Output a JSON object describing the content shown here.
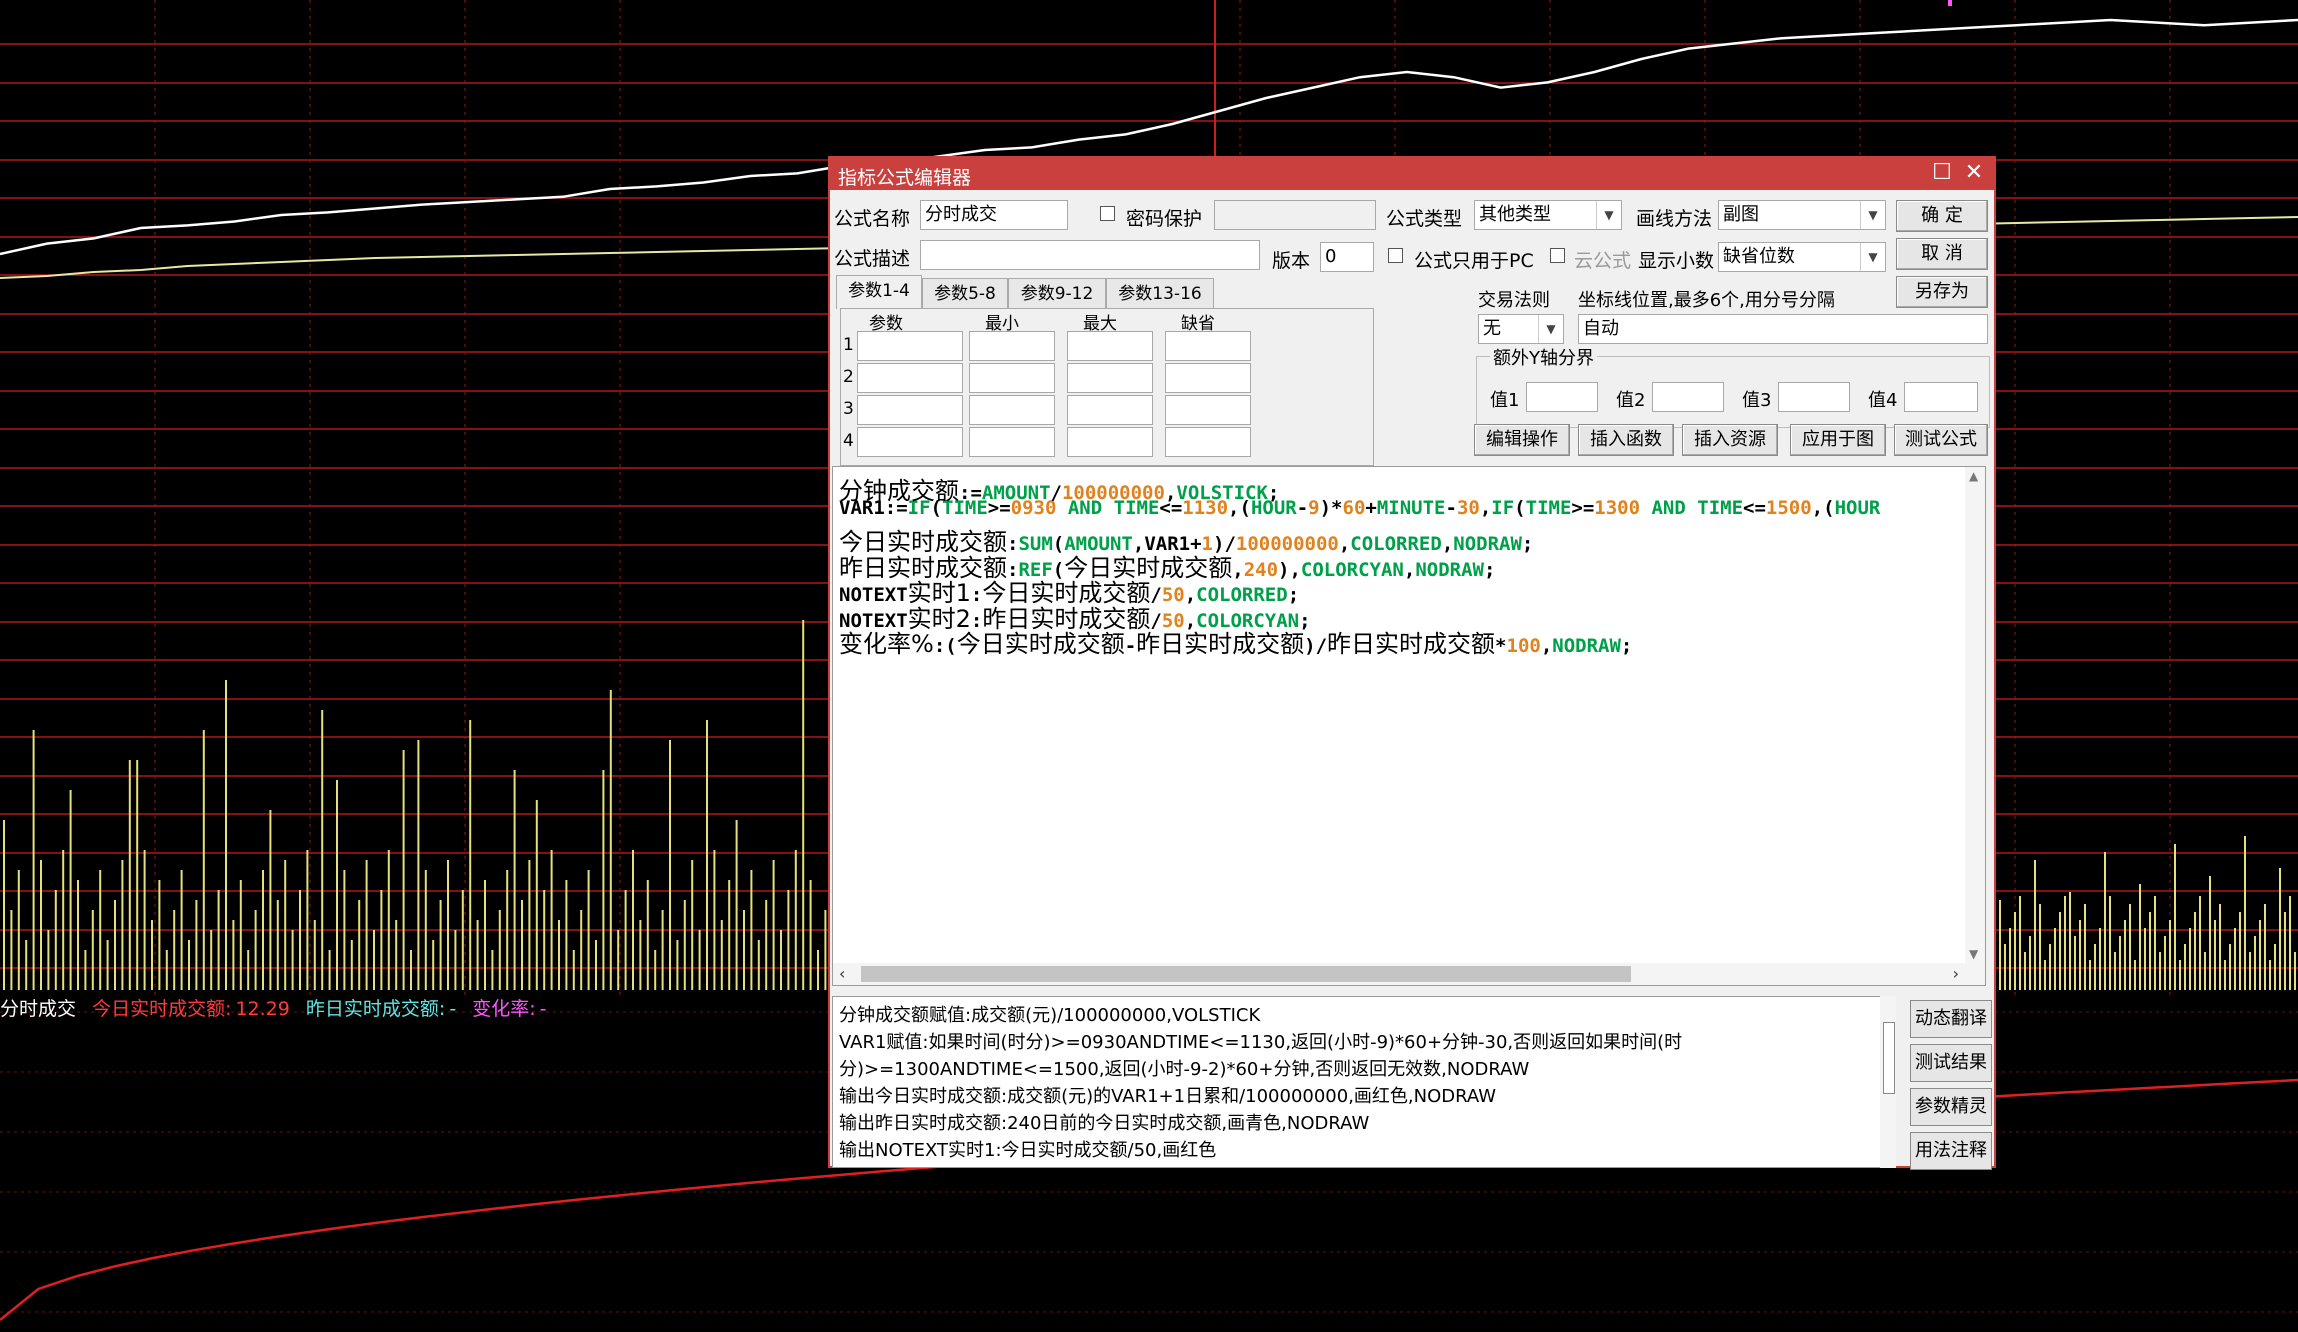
{
  "chart_data": {
    "type": "line",
    "title": "",
    "xlabel": "",
    "ylabel": "",
    "series": [
      {
        "name": "",
        "color": "#ffffff",
        "values": [
          180,
          172,
          168,
          160,
          158,
          155,
          150,
          148,
          145,
          142,
          140,
          138,
          136,
          130,
          128,
          125,
          120,
          118,
          112,
          110,
          105,
          100,
          98,
          92,
          88,
          80,
          70,
          60,
          52,
          44,
          40,
          44,
          52,
          48,
          40,
          30,
          22,
          18,
          14,
          12,
          10,
          8,
          6,
          4,
          2,
          0,
          2,
          4,
          2,
          0
        ]
      },
      {
        "name": "",
        "color": "#e8e8a0",
        "values": [
          178,
          176,
          172,
          170,
          166,
          164,
          162,
          160,
          158,
          157,
          156,
          155,
          154,
          153,
          152,
          151,
          150,
          149,
          148,
          147,
          146,
          145,
          144,
          143,
          142,
          141,
          140,
          139,
          138,
          137,
          136,
          135,
          134,
          133,
          132,
          131,
          130,
          129,
          128,
          127,
          126,
          125,
          124,
          123,
          122,
          121,
          120,
          119,
          118,
          117
        ]
      }
    ]
  },
  "legend": {
    "name": "分时成交",
    "today_label": "今日实时成交额:",
    "today_value": "12.29",
    "yesterday_label": "昨日实时成交额:",
    "yesterday_value": "-",
    "change_label": "变化率:",
    "change_value": "-",
    "colors": {
      "name": "#ffffff",
      "today": "#ff3b3b",
      "yesterday": "#5ee6e6",
      "change": "#ff55ff"
    }
  },
  "dialog": {
    "title": "指标公式编辑器",
    "name_label": "公式名称",
    "name_value": "分时成交",
    "password_label": "密码保护",
    "type_label": "公式类型",
    "type_value": "其他类型",
    "draw_label": "画线方法",
    "draw_value": "副图",
    "ok": "确  定",
    "cancel": "取  消",
    "save_as": "另存为",
    "desc_label": "公式描述",
    "version_label": "版本",
    "version_value": "0",
    "pc_only_label": "公式只用于PC",
    "cloud_label": "云公式",
    "decimals_label": "显示小数",
    "decimals_value": "缺省位数",
    "tabs": [
      "参数1-4",
      "参数5-8",
      "参数9-12",
      "参数13-16"
    ],
    "param_headers": [
      "参数",
      "最小",
      "最大",
      "缺省"
    ],
    "param_rows": [
      "1",
      "2",
      "3",
      "4"
    ],
    "trade_rule_label": "交易法则",
    "trade_rule_value": "无",
    "coord_label": "坐标线位置,最多6个,用分号分隔",
    "coord_value": "自动",
    "y_axis_label": "额外Y轴分界",
    "val_labels": [
      "值1",
      "值2",
      "值3",
      "值4"
    ],
    "buttons": [
      "编辑操作",
      "插入函数",
      "插入资源",
      "应用于图",
      "测试公式"
    ],
    "side_buttons": [
      "动态翻译",
      "测试结果",
      "参数精灵",
      "用法注释"
    ]
  },
  "code_lines": [
    [
      [
        "分钟成交额",
        "cn"
      ],
      [
        ":=",
        "p"
      ],
      [
        "AMOUNT",
        "k"
      ],
      [
        "/",
        "p"
      ],
      [
        "100000000",
        "n"
      ],
      [
        ",",
        "p"
      ],
      [
        "VOLSTICK",
        "k"
      ],
      [
        ";",
        "p"
      ]
    ],
    [
      [
        "VAR1",
        "p"
      ],
      [
        ":=",
        "p"
      ],
      [
        "IF",
        "k"
      ],
      [
        "(",
        "p"
      ],
      [
        "TIME",
        "k"
      ],
      [
        ">=",
        "p"
      ],
      [
        "0930",
        "n"
      ],
      [
        " AND ",
        "k"
      ],
      [
        "TIME",
        "k"
      ],
      [
        "<=",
        "p"
      ],
      [
        "1130",
        "n"
      ],
      [
        ",(",
        "p"
      ],
      [
        "HOUR",
        "k"
      ],
      [
        "-",
        "p"
      ],
      [
        "9",
        "n"
      ],
      [
        ")*",
        "p"
      ],
      [
        "60",
        "n"
      ],
      [
        "+",
        "p"
      ],
      [
        "MINUTE",
        "k"
      ],
      [
        "-",
        "p"
      ],
      [
        "30",
        "n"
      ],
      [
        ",",
        "p"
      ],
      [
        "IF",
        "k"
      ],
      [
        "(",
        "p"
      ],
      [
        "TIME",
        "k"
      ],
      [
        ">=",
        "p"
      ],
      [
        "1300",
        "n"
      ],
      [
        " AND ",
        "k"
      ],
      [
        "TIME",
        "k"
      ],
      [
        "<=",
        "p"
      ],
      [
        "1500",
        "n"
      ],
      [
        ",(",
        "p"
      ],
      [
        "HOUR",
        "k"
      ]
    ],
    [
      [
        "今日实时成交额",
        "cn"
      ],
      [
        ":",
        "p"
      ],
      [
        "SUM",
        "k"
      ],
      [
        "(",
        "p"
      ],
      [
        "AMOUNT",
        "k"
      ],
      [
        ",",
        "p"
      ],
      [
        "VAR1",
        "p"
      ],
      [
        "+",
        "p"
      ],
      [
        "1",
        "n"
      ],
      [
        ")/",
        "p"
      ],
      [
        "100000000",
        "n"
      ],
      [
        ",",
        "p"
      ],
      [
        "COLORRED",
        "k"
      ],
      [
        ",",
        "p"
      ],
      [
        "NODRAW",
        "k"
      ],
      [
        ";",
        "p"
      ]
    ],
    [
      [
        "昨日实时成交额",
        "cn"
      ],
      [
        ":",
        "p"
      ],
      [
        "REF",
        "k"
      ],
      [
        "(",
        "p"
      ],
      [
        "今日实时成交额",
        "cn"
      ],
      [
        ",",
        "p"
      ],
      [
        "240",
        "n"
      ],
      [
        "),",
        "p"
      ],
      [
        "COLORCYAN",
        "k"
      ],
      [
        ",",
        "p"
      ],
      [
        "NODRAW",
        "k"
      ],
      [
        ";",
        "p"
      ]
    ],
    [
      [
        "NOTEXT",
        "p"
      ],
      [
        "实时1",
        "cn"
      ],
      [
        ":",
        "p"
      ],
      [
        "今日实时成交额",
        "cn"
      ],
      [
        "/",
        "p"
      ],
      [
        "50",
        "n"
      ],
      [
        ",",
        "p"
      ],
      [
        "COLORRED",
        "k"
      ],
      [
        ";",
        "p"
      ]
    ],
    [
      [
        "NOTEXT",
        "p"
      ],
      [
        "实时2",
        "cn"
      ],
      [
        ":",
        "p"
      ],
      [
        "昨日实时成交额",
        "cn"
      ],
      [
        "/",
        "p"
      ],
      [
        "50",
        "n"
      ],
      [
        ",",
        "p"
      ],
      [
        "COLORCYAN",
        "k"
      ],
      [
        ";",
        "p"
      ]
    ],
    [
      [
        "变化率%",
        "cn"
      ],
      [
        ":(",
        "p"
      ],
      [
        "今日实时成交额",
        "cn"
      ],
      [
        "-",
        "p"
      ],
      [
        "昨日实时成交额",
        "cn"
      ],
      [
        ")/",
        "p"
      ],
      [
        "昨日实时成交额",
        "cn"
      ],
      [
        "*",
        "p"
      ],
      [
        "100",
        "n"
      ],
      [
        ",",
        "p"
      ],
      [
        "NODRAW",
        "k"
      ],
      [
        ";",
        "p"
      ]
    ]
  ],
  "desc_lines": [
    "分钟成交额赋值:成交额(元)/100000000,VOLSTICK",
    "VAR1赋值:如果时间(时分)>=0930ANDTIME<=1130,返回(小时-9)*60+分钟-30,否则返回如果时间(时",
    "分)>=1300ANDTIME<=1500,返回(小时-9-2)*60+分钟,否则返回无效数,NODRAW",
    "输出今日实时成交额:成交额(元)的VAR1+1日累和/100000000,画红色,NODRAW",
    "输出昨日实时成交额:240日前的今日实时成交额,画青色,NODRAW",
    "输出NOTEXT实时1:今日实时成交额/50,画红色"
  ]
}
